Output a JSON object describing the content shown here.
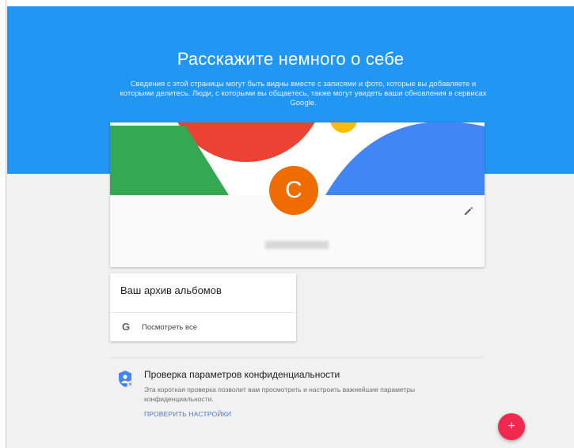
{
  "header": {
    "title": "Расскажите немного о себе",
    "description": "Сведения с этой страницы могут быть видны вместе с записями и фото, которые вы добавляете и которыми делитесь. Люди, с которыми вы общаетесь, также могут увидеть ваши обновления в сервисах Google."
  },
  "profile": {
    "avatar_letter": "C",
    "name": ""
  },
  "albums": {
    "title": "Ваш архив альбомов",
    "view_all_icon": "G",
    "view_all_label": "Посмотреть все"
  },
  "privacy": {
    "title": "Проверка параметров конфиденциальности",
    "description": "Эта короткая проверка позволит вам просмотреть и настроить важнейшие параметры конфиденциальности.",
    "link_label": "ПРОВЕРИТЬ НАСТРОЙКИ"
  },
  "fab": {
    "label": "+"
  },
  "icons": [
    "pencil-icon",
    "google-g-icon",
    "shield-icon",
    "plus-icon"
  ],
  "colors": {
    "header_bg": "#2196f3",
    "avatar_bg": "#ef6c00",
    "fab_bg": "#f0294f",
    "link": "#3f7be0",
    "banner_red": "#ea4335",
    "banner_green": "#34a853",
    "banner_blue": "#4285f4",
    "banner_yellow": "#fbbc05"
  }
}
